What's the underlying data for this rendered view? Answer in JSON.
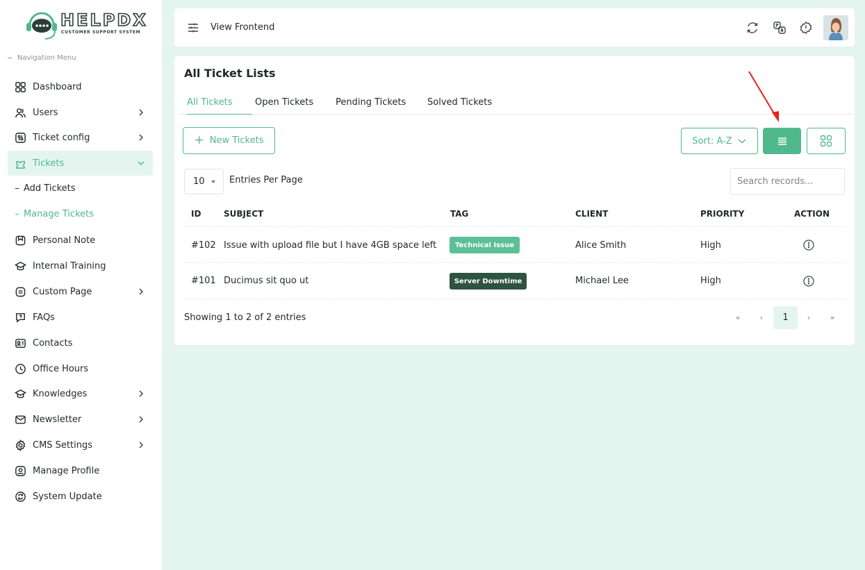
{
  "brand": {
    "name": "HELPDX",
    "tagline": "CUSTOMER SUPPORT SYSTEM"
  },
  "sidebar": {
    "heading": "Navigation Menu",
    "items": [
      {
        "label": "Dashboard",
        "icon": "dashboard-icon"
      },
      {
        "label": "Users",
        "icon": "users-icon",
        "has_children": true
      },
      {
        "label": "Ticket config",
        "icon": "ticket-config-icon",
        "has_children": true
      },
      {
        "label": "Tickets",
        "icon": "tickets-icon",
        "has_children": true,
        "active": true,
        "children": [
          "Add Tickets",
          "Manage Tickets"
        ]
      },
      {
        "label": "Personal Note",
        "icon": "note-icon"
      },
      {
        "label": "Internal Training",
        "icon": "training-icon"
      },
      {
        "label": "Custom Page",
        "icon": "custom-page-icon",
        "has_children": true
      },
      {
        "label": "FAQs",
        "icon": "faq-icon"
      },
      {
        "label": "Contacts",
        "icon": "contacts-icon"
      },
      {
        "label": "Office Hours",
        "icon": "clock-icon"
      },
      {
        "label": "Knowledges",
        "icon": "knowledge-icon",
        "has_children": true
      },
      {
        "label": "Newsletter",
        "icon": "newsletter-icon",
        "has_children": true
      },
      {
        "label": "CMS Settings",
        "icon": "gear-icon",
        "has_children": true
      },
      {
        "label": "Manage Profile",
        "icon": "profile-icon"
      },
      {
        "label": "System Update",
        "icon": "update-icon"
      }
    ],
    "sub_items": {
      "add": "Add Tickets",
      "manage": "Manage Tickets"
    }
  },
  "topbar": {
    "view_frontend": "View Frontend"
  },
  "page": {
    "title": "All Ticket Lists",
    "tabs": [
      "All Tickets",
      "Open Tickets",
      "Pending Tickets",
      "Solved Tickets"
    ],
    "new_button": "New Tickets",
    "sort_label": "Sort: A-Z",
    "entries_value": "10",
    "entries_label": "Entries Per Page",
    "search_placeholder": "Search records...",
    "columns": [
      "ID",
      "SUBJECT",
      "TAG",
      "CLIENT",
      "PRIORITY",
      "ACTION"
    ],
    "rows": [
      {
        "id": "#102",
        "subject": "Issue with upload file but I have 4GB space left",
        "tag": "Technical Issue",
        "client": "Alice Smith",
        "priority": "High"
      },
      {
        "id": "#101",
        "subject": "Ducimus sit quo ut",
        "tag": "Server Downtime",
        "client": "Michael Lee",
        "priority": "High"
      }
    ],
    "showing": "Showing 1 to 2 of 2 entries",
    "pagination": {
      "first": "«",
      "prev": "‹",
      "current": "1",
      "next": "›",
      "last": "»"
    }
  },
  "colors": {
    "accent": "#4fb98c",
    "dark_tag": "#2e5244",
    "light_tag": "#5cbf95",
    "background": "#e4f5ef"
  }
}
